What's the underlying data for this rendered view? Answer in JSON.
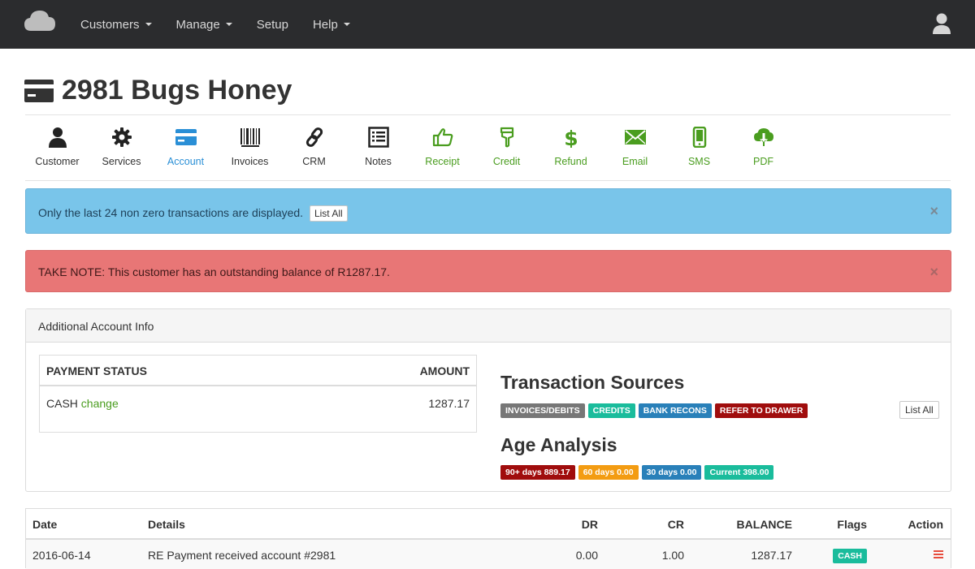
{
  "nav": {
    "items": [
      {
        "label": "Customers",
        "dropdown": true
      },
      {
        "label": "Manage",
        "dropdown": true
      },
      {
        "label": "Setup",
        "dropdown": false
      },
      {
        "label": "Help",
        "dropdown": true
      }
    ]
  },
  "page": {
    "title": "2981 Bugs Honey"
  },
  "toolbar": {
    "customer": "Customer",
    "services": "Services",
    "account": "Account",
    "invoices": "Invoices",
    "crm": "CRM",
    "notes": "Notes",
    "receipt": "Receipt",
    "credit": "Credit",
    "refund": "Refund",
    "email": "Email",
    "sms": "SMS",
    "pdf": "PDF"
  },
  "alerts": {
    "info_text": "Only the last 24 non zero transactions are displayed.",
    "info_button": "List All",
    "danger_text": "TAKE NOTE: This customer has an outstanding balance of R1287.17.",
    "close_glyph": "×"
  },
  "panel": {
    "heading": "Additional Account Info",
    "payment": {
      "col_status": "PAYMENT STATUS",
      "col_amount": "AMOUNT",
      "status": "CASH",
      "change_link": "change",
      "amount": "1287.17"
    },
    "sources": {
      "title": "Transaction Sources",
      "badges": [
        "INVOICES/DEBITS",
        "CREDITS",
        "BANK RECONS",
        "REFER TO DRAWER"
      ],
      "list_all": "List All"
    },
    "age": {
      "title": "Age Analysis",
      "badges": [
        "90+ days 889.17",
        "60 days 0.00",
        "30 days 0.00",
        "Current 398.00"
      ]
    }
  },
  "transactions": {
    "columns": {
      "date": "Date",
      "details": "Details",
      "dr": "DR",
      "cr": "CR",
      "balance": "BALANCE",
      "flags": "Flags",
      "action": "Action"
    },
    "rows": [
      {
        "date": "2016-06-14",
        "details": "RE Payment received account #2981",
        "dr": "0.00",
        "cr": "1.00",
        "balance": "1287.17",
        "flag": "CASH"
      }
    ]
  },
  "colors": {
    "navbar": "#2b2c2e",
    "accent_blue": "#2a8fd6",
    "accent_green": "#4a9d1f",
    "info_bg": "#79c5ea",
    "danger_bg": "#e87676",
    "badge_gray": "#777777",
    "badge_teal": "#1abc9c",
    "badge_blue": "#2980b9",
    "badge_red": "#a00d0d",
    "badge_orange": "#f39c12"
  }
}
